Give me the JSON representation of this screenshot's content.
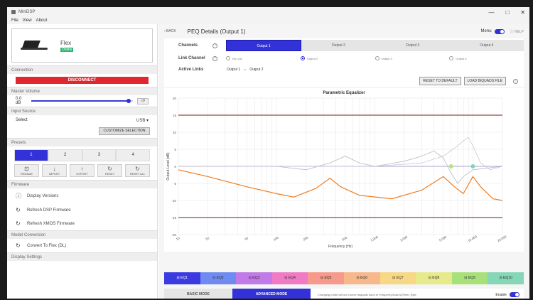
{
  "window": {
    "title": "MiniDSP",
    "controls": [
      "—",
      "□",
      "✕"
    ]
  },
  "menubar": [
    "File",
    "View",
    "About"
  ],
  "sidebar": {
    "device": {
      "name": "Flex",
      "status": "Online"
    },
    "sections": {
      "connection": "Connection",
      "master_volume": "Master Volume",
      "input_source": "Input Source",
      "presets": "Presets",
      "firmware": "Firmware",
      "model_conversion": "Model Conversion",
      "display_settings": "Display Settings"
    },
    "disconnect_label": "DISCONNECT",
    "volume": {
      "value_label": "0.0 dB",
      "level": 0.96,
      "mute_label": "◁×"
    },
    "input_select": {
      "label": "Select",
      "value": "USB ▾"
    },
    "customize_label": "CUSTOMIZE SELECTION",
    "presets": [
      "1",
      "2",
      "3",
      "4"
    ],
    "active_preset": 0,
    "actions": [
      {
        "icon": "⊡",
        "label": "RENAME"
      },
      {
        "icon": "↓",
        "label": "IMPORT"
      },
      {
        "icon": "↑",
        "label": "EXPORT"
      },
      {
        "icon": "↻",
        "label": "RESET"
      },
      {
        "icon": "↻",
        "label": "RESET ALL"
      }
    ],
    "firmware_items": [
      {
        "icon": "ⓘ",
        "label": "Display Versions"
      },
      {
        "icon": "↻",
        "label": "Refresh DSP Firmware"
      },
      {
        "icon": "↻",
        "label": "Refresh XMOS Firmware"
      }
    ],
    "conversion_item": {
      "icon": "↻",
      "label": "Convert To Flex (DL)"
    }
  },
  "header": {
    "back": "‹ BACK",
    "title": "PEQ Details (Output 1)",
    "menu_label": "Menu",
    "help": "ⓘ HELP"
  },
  "channels": {
    "label": "Channels",
    "tabs": [
      "Output 1",
      "Output 2",
      "Output 3",
      "Output 4"
    ],
    "active": 0
  },
  "link_channel": {
    "label": "Link Channel",
    "options": [
      "No Link",
      "Output 2",
      "Output 3",
      "Output 4"
    ],
    "checked": 1
  },
  "active_links": {
    "label": "Active Links",
    "from": "Output 1",
    "sep": "⇔",
    "to": "Output 2"
  },
  "buttons": {
    "reset": "RESET TO DEFAULT",
    "load": "LOAD BIQUADS FILE"
  },
  "chart_data": {
    "type": "line",
    "title": "Parametric Equalizer",
    "xlabel": "Frequency (Hz)",
    "ylabel": "Output Level (dB)",
    "xscale": "log",
    "xlim": [
      10,
      20000
    ],
    "ylim": [
      -20,
      20
    ],
    "x_ticks": [
      "10",
      "20",
      "50",
      "100",
      "200",
      "500",
      "1,000",
      "2,000",
      "5,000",
      "10,000",
      "20,000"
    ],
    "x_tick_values": [
      10,
      20,
      50,
      100,
      200,
      500,
      1000,
      2000,
      5000,
      10000,
      20000
    ],
    "y_ticks": [
      20,
      15,
      10,
      5,
      0,
      -5,
      -10,
      -15,
      -20
    ],
    "limit_lines": [
      15,
      -15
    ],
    "series": [
      {
        "color": "#ef7d22",
        "points": [
          [
            10,
            -1
          ],
          [
            20,
            -3
          ],
          [
            50,
            -6
          ],
          [
            100,
            -8
          ],
          [
            150,
            -9
          ],
          [
            250,
            -6.5
          ],
          [
            350,
            -3.5
          ],
          [
            450,
            -6
          ],
          [
            700,
            -8.5
          ],
          [
            1500,
            -9.5
          ],
          [
            3000,
            -7
          ],
          [
            5000,
            -3
          ],
          [
            6500,
            -6
          ],
          [
            8000,
            -8
          ],
          [
            10000,
            -3
          ],
          [
            12000,
            -6
          ],
          [
            16000,
            -9.5
          ],
          [
            20000,
            -10
          ]
        ]
      },
      {
        "color": "#b8b8c8",
        "points": [
          [
            10,
            0
          ],
          [
            100,
            0
          ],
          [
            200,
            -1
          ],
          [
            350,
            1
          ],
          [
            500,
            3
          ],
          [
            700,
            1
          ],
          [
            1000,
            0
          ],
          [
            2000,
            1.5
          ],
          [
            3000,
            3
          ],
          [
            4000,
            4.5
          ],
          [
            5000,
            2.5
          ],
          [
            6000,
            -2
          ],
          [
            7000,
            -5
          ],
          [
            8000,
            -3
          ],
          [
            10000,
            -1
          ],
          [
            20000,
            0
          ]
        ]
      },
      {
        "color": "#c8c8d4",
        "points": [
          [
            10,
            0
          ],
          [
            1000,
            0
          ],
          [
            3000,
            1
          ],
          [
            5000,
            3
          ],
          [
            7000,
            6
          ],
          [
            8000,
            7.5
          ],
          [
            9000,
            8.5
          ],
          [
            10000,
            6
          ],
          [
            12000,
            1
          ],
          [
            15000,
            -1
          ],
          [
            20000,
            0
          ]
        ]
      }
    ],
    "markers": [
      {
        "x": 6000,
        "y": 0,
        "color": "#b6e57a"
      },
      {
        "x": 10000,
        "y": 0,
        "color": "#7fd6b8"
      }
    ]
  },
  "eq_tabs": [
    {
      "label": "EQ1",
      "color": "#3a3ae0"
    },
    {
      "label": "EQ2",
      "color": "#6f8af0"
    },
    {
      "label": "EQ3",
      "color": "#c27ae8"
    },
    {
      "label": "EQ4",
      "color": "#f07ac4"
    },
    {
      "label": "EQ5",
      "color": "#f79a8c"
    },
    {
      "label": "EQ6",
      "color": "#f7b98c"
    },
    {
      "label": "EQ7",
      "color": "#f7d884"
    },
    {
      "label": "EQ8",
      "color": "#e6ea8a"
    },
    {
      "label": "EQ9",
      "color": "#a8e07a"
    },
    {
      "label": "EQ10",
      "color": "#86d6b8"
    }
  ],
  "modes": {
    "basic": "BASIC MODE",
    "advanced": "ADVANCED MODE"
  },
  "mode_note": "Changing mode will not convert biquads back to Frequency/Gain/Q/Filter-Type.",
  "enable_label": "Enable"
}
